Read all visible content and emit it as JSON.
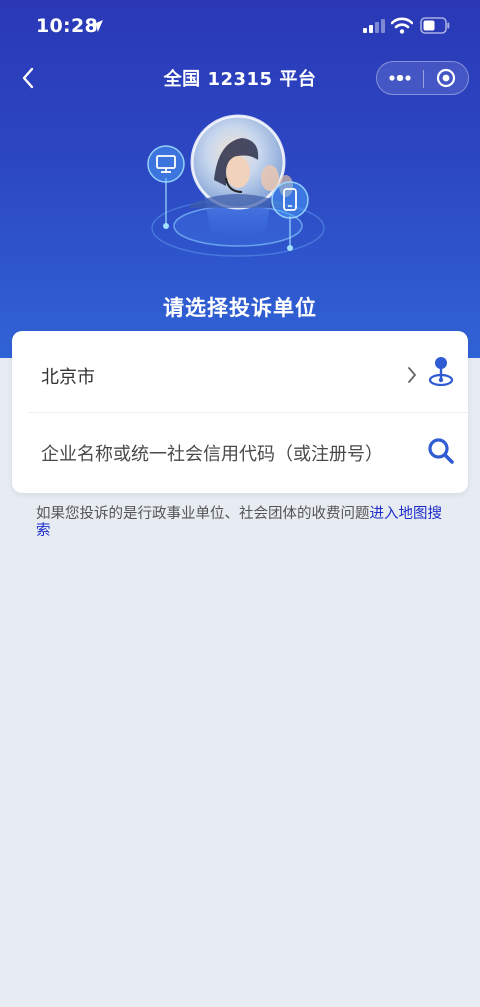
{
  "status_bar": {
    "time": "10:28",
    "icons": [
      "location-arrow-icon",
      "signal-icon",
      "wifi-icon",
      "battery-icon"
    ]
  },
  "nav": {
    "title": "全国 12315 平台",
    "icons": [
      "back-arrow-icon",
      "more-dots-icon",
      "close-target-icon"
    ]
  },
  "hero": {
    "section_title": "请选择投诉单位",
    "illustration": [
      "headset-operator-avatar",
      "monitor-icon",
      "mobile-phone-icon"
    ]
  },
  "form": {
    "region": "北京市",
    "search_placeholder": "企业名称或统一社会信用代码（或注册号）"
  },
  "note": {
    "text": "如果您投诉的是行政事业单位、社会团体的收费问题",
    "link": "进入地图搜索"
  },
  "colors": {
    "hero_top": "#2a38b6",
    "hero_bottom": "#3063d6",
    "accent": "#2f5bd3",
    "link": "#1d2dcc",
    "page_bg": "#e7ebf2"
  }
}
